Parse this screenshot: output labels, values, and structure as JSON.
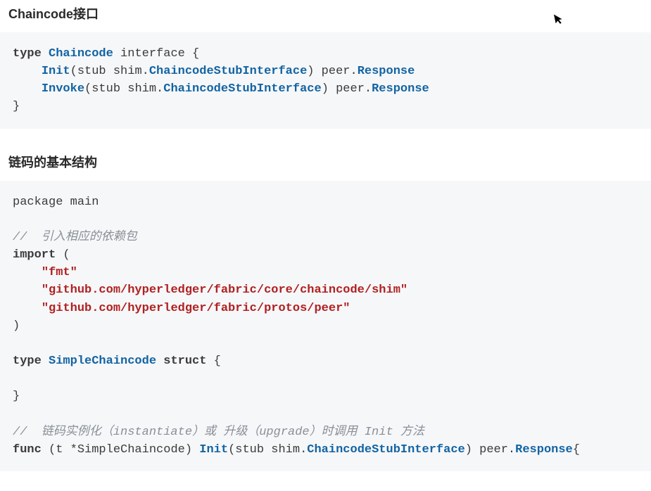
{
  "section1": {
    "heading": "Chaincode接口",
    "code": {
      "l1_kw1": "type",
      "l1_type": "Chaincode",
      "l1_rest": " interface {",
      "l2_indent": "    ",
      "l2_method": "Init",
      "l2_mid1": "(stub shim.",
      "l2_type1": "ChaincodeStubInterface",
      "l2_mid2": ") peer.",
      "l2_type2": "Response",
      "l3_indent": "    ",
      "l3_method": "Invoke",
      "l3_mid1": "(stub shim.",
      "l3_type1": "ChaincodeStubInterface",
      "l3_mid2": ") peer.",
      "l3_type2": "Response",
      "l4": "}"
    }
  },
  "section2": {
    "heading": "链码的基本结构",
    "code": {
      "l1": "package main",
      "blank1": "",
      "c1": "//  引入相应的依赖包",
      "l2_kw": "import",
      "l2_rest": " (",
      "l3_indent": "    ",
      "l3_str": "\"fmt\"",
      "l4_indent": "    ",
      "l4_str": "\"github.com/hyperledger/fabric/core/chaincode/shim\"",
      "l5_indent": "    ",
      "l5_str": "\"github.com/hyperledger/fabric/protos/peer\"",
      "l6": ")",
      "blank2": "",
      "l7_kw1": "type",
      "l7_type": "SimpleChaincode",
      "l7_kw2": "struct",
      "l7_rest": " {",
      "blank3": "",
      "l8": "}",
      "blank4": "",
      "c2": "//  链码实例化（instantiate）或 升级（upgrade）时调用 Init 方法",
      "l9_kw": "func",
      "l9_mid1": " (t *SimpleChaincode) ",
      "l9_method": "Init",
      "l9_mid2": "(stub shim.",
      "l9_type1": "ChaincodeStubInterface",
      "l9_mid3": ") peer.",
      "l9_type2": "Response",
      "l9_rest": "{"
    }
  },
  "cursor": "➤"
}
